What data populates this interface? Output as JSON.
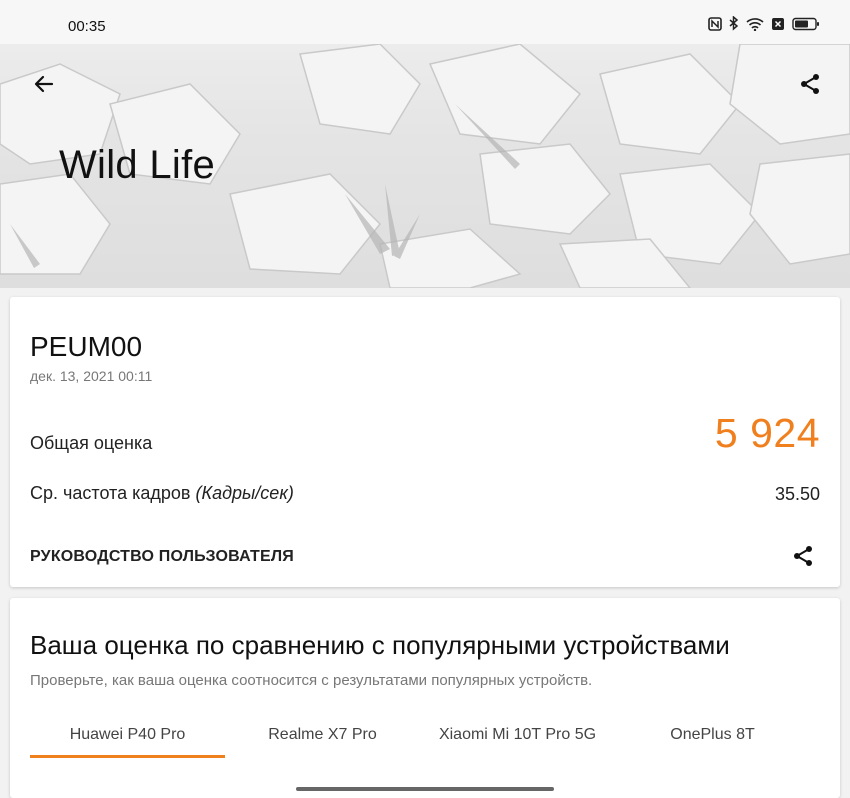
{
  "status_bar": {
    "time": "00:35",
    "icons": [
      "nfc-icon",
      "bluetooth-icon",
      "wifi-icon",
      "sim-icon",
      "battery-icon"
    ]
  },
  "header": {
    "title": "Wild Life",
    "back_icon": "arrow-left-icon",
    "share_icon": "share-icon"
  },
  "result": {
    "device_name": "PEUM00",
    "date": "дек. 13, 2021 00:11",
    "score_label": "Общая оценка",
    "score_value": "5 924",
    "fps_label": "Ср. частота кадров ",
    "fps_unit": "(Кадры/сек)",
    "fps_value": "35.50",
    "guide_label": "РУКОВОДСТВО ПОЛЬЗОВАТЕЛЯ",
    "share_icon": "share-icon"
  },
  "compare": {
    "title": "Ваша оценка по сравнению с популярными устройствами",
    "subtitle": "Проверьте, как ваша оценка соотносится с результатами популярных устройств.",
    "tabs": [
      {
        "label": "Huawei P40 Pro",
        "active": true
      },
      {
        "label": "Realme X7 Pro",
        "active": false
      },
      {
        "label": "Xiaomi Mi 10T Pro 5G",
        "active": false
      },
      {
        "label": "OnePlus 8T",
        "active": false
      }
    ]
  },
  "colors": {
    "accent": "#f07f1e",
    "background": "#f2f2f2",
    "card": "#ffffff"
  }
}
